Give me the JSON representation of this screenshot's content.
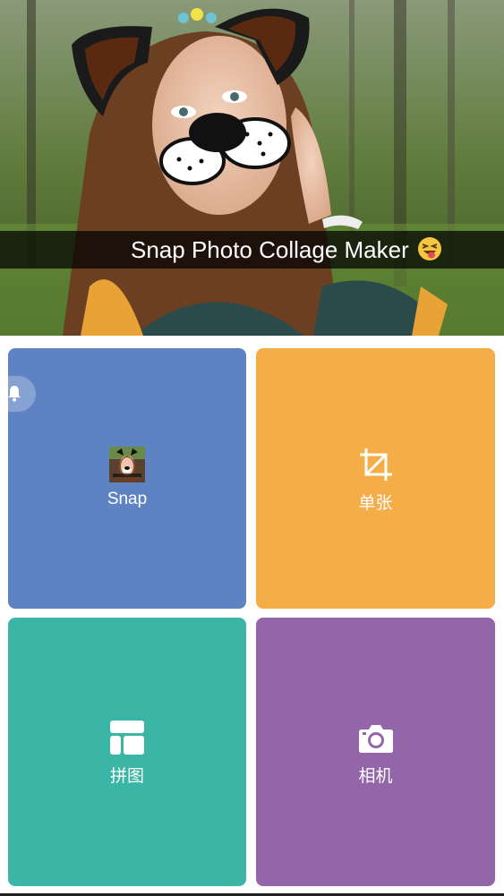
{
  "banner": {
    "title": "Snap Photo Collage Maker"
  },
  "tiles": {
    "snap": {
      "label": "Snap",
      "color": "#5e83c3"
    },
    "single": {
      "label": "单张",
      "color": "#f5ad48"
    },
    "collage": {
      "label": "拼图",
      "color": "#3bb5a6"
    },
    "camera": {
      "label": "相机",
      "color": "#9366aa"
    }
  },
  "icons": {
    "snap": "snap-thumbnail-icon",
    "single": "crop-icon",
    "collage": "collage-grid-icon",
    "camera": "camera-icon",
    "notification": "bell-icon",
    "emoji": "laughing-tongue-emoji"
  }
}
